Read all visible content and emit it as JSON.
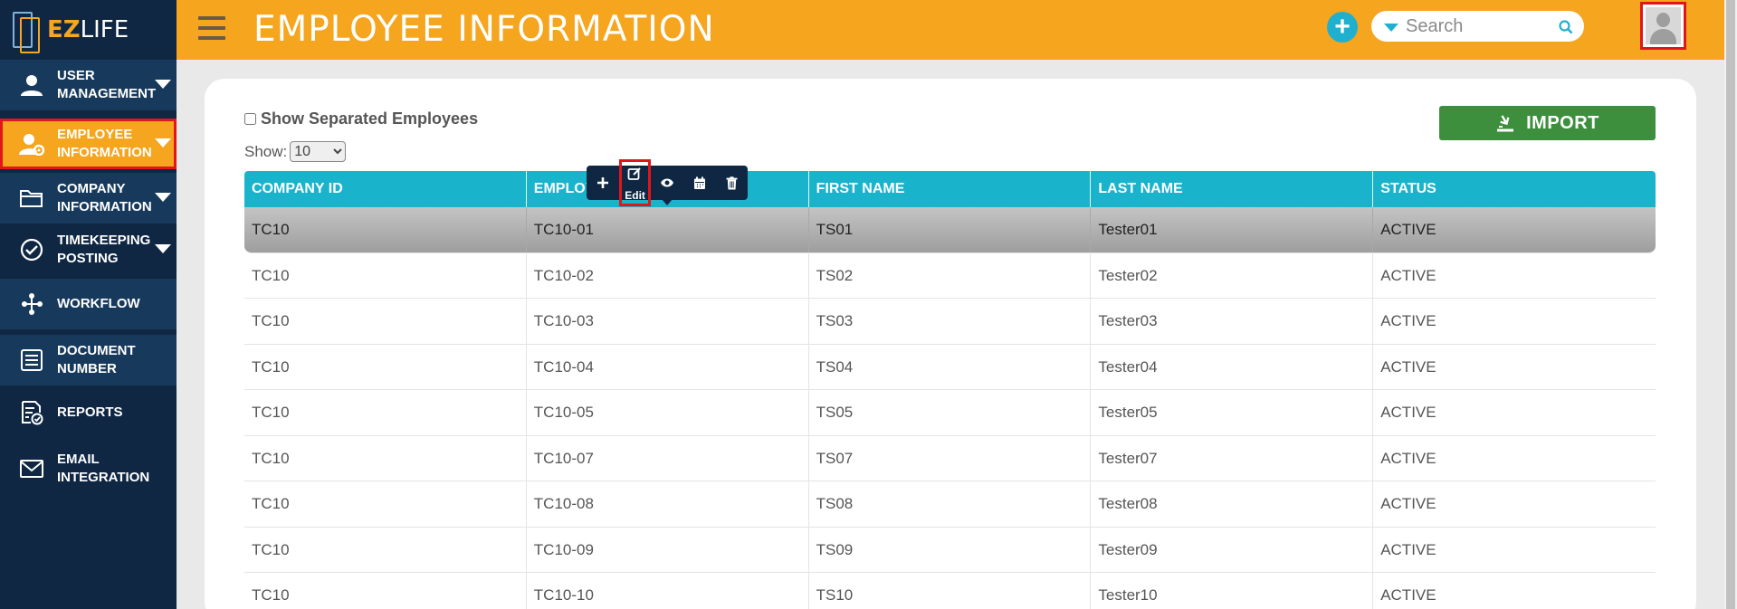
{
  "app": {
    "logo_prefix": "EZ",
    "logo_suffix": "LIFE"
  },
  "sidebar": {
    "items": [
      {
        "line1": "USER",
        "line2": "MANAGEMENT",
        "icon": "user-icon"
      },
      {
        "line1": "EMPLOYEE",
        "line2": "INFORMATION",
        "icon": "user-gear-icon"
      },
      {
        "line1": "COMPANY",
        "line2": "INFORMATION",
        "icon": "folder-icon"
      },
      {
        "line1": "TIMEKEEPING",
        "line2": "POSTING",
        "icon": "check-circle-icon"
      },
      {
        "line1": "WORKFLOW",
        "line2": "",
        "icon": "workflow-icon"
      },
      {
        "line1": "DOCUMENT",
        "line2": "NUMBER",
        "icon": "list-icon"
      },
      {
        "line1": "REPORTS",
        "line2": "",
        "icon": "report-icon"
      },
      {
        "line1": "EMAIL",
        "line2": "INTEGRATION",
        "icon": "mail-icon"
      }
    ]
  },
  "header": {
    "title": "EMPLOYEE INFORMATION",
    "search_placeholder": "Search"
  },
  "filters": {
    "show_separated_label": "Show Separated Employees",
    "show_label": "Show:",
    "page_size": "10"
  },
  "import_label": "IMPORT",
  "action_bar": {
    "edit_tooltip": "Edit"
  },
  "table": {
    "columns": [
      "COMPANY ID",
      "EMPLOYEE ID",
      "FIRST NAME",
      "LAST NAME",
      "STATUS"
    ],
    "column_visible_text": [
      "COMPANY ID",
      "EMPLOY",
      "FIRST NAME",
      "LAST NAME",
      "STATUS"
    ],
    "rows": [
      [
        "TC10",
        "TC10-01",
        "TS01",
        "Tester01",
        "ACTIVE"
      ],
      [
        "TC10",
        "TC10-02",
        "TS02",
        "Tester02",
        "ACTIVE"
      ],
      [
        "TC10",
        "TC10-03",
        "TS03",
        "Tester03",
        "ACTIVE"
      ],
      [
        "TC10",
        "TC10-04",
        "TS04",
        "Tester04",
        "ACTIVE"
      ],
      [
        "TC10",
        "TC10-05",
        "TS05",
        "Tester05",
        "ACTIVE"
      ],
      [
        "TC10",
        "TC10-07",
        "TS07",
        "Tester07",
        "ACTIVE"
      ],
      [
        "TC10",
        "TC10-08",
        "TS08",
        "Tester08",
        "ACTIVE"
      ],
      [
        "TC10",
        "TC10-09",
        "TS09",
        "Tester09",
        "ACTIVE"
      ],
      [
        "TC10",
        "TC10-10",
        "TS10",
        "Tester10",
        "ACTIVE"
      ]
    ]
  },
  "colors": {
    "header_bg": "#f5a51e",
    "sidebar_bg": "#0f2743",
    "table_header_bg": "#1ab3cc",
    "import_bg": "#3d8f3e",
    "highlight_red": "#e0161b"
  }
}
